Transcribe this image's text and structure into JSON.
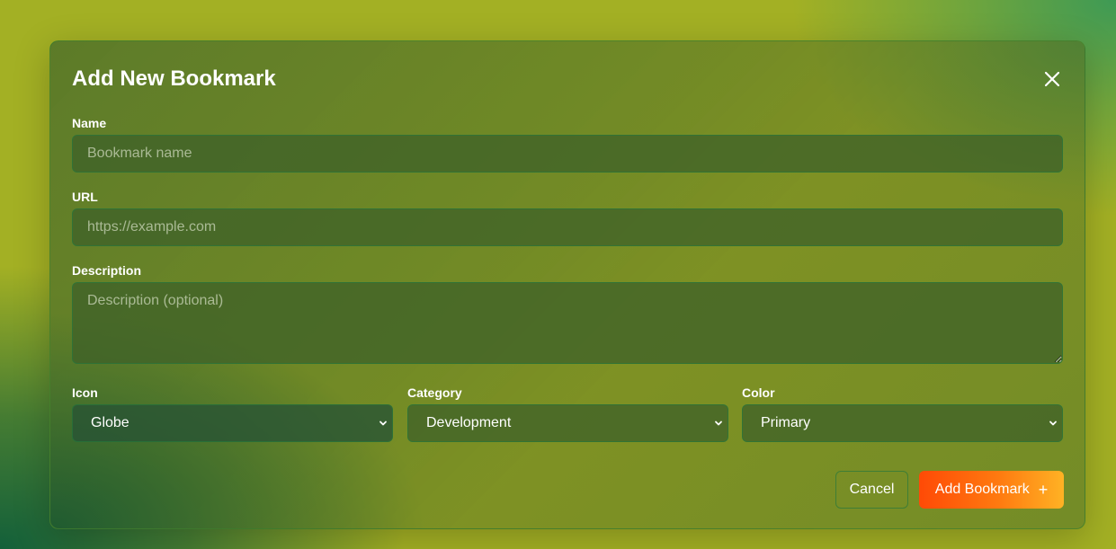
{
  "modal": {
    "title": "Add New Bookmark",
    "fields": {
      "name": {
        "label": "Name",
        "placeholder": "Bookmark name",
        "value": ""
      },
      "url": {
        "label": "URL",
        "placeholder": "https://example.com",
        "value": ""
      },
      "description": {
        "label": "Description",
        "placeholder": "Description (optional)",
        "value": ""
      },
      "icon": {
        "label": "Icon",
        "selected": "Globe"
      },
      "category": {
        "label": "Category",
        "selected": "Development"
      },
      "color": {
        "label": "Color",
        "selected": "Primary"
      }
    },
    "buttons": {
      "cancel": "Cancel",
      "add": "Add Bookmark",
      "add_icon": "+"
    }
  },
  "icons": {
    "close": "close-icon",
    "chevron": "chevron-down-icon",
    "plus": "plus-icon"
  },
  "colors": {
    "accent_start": "#ff4a06",
    "accent_end": "#ffb224",
    "text": "#ffffff"
  }
}
